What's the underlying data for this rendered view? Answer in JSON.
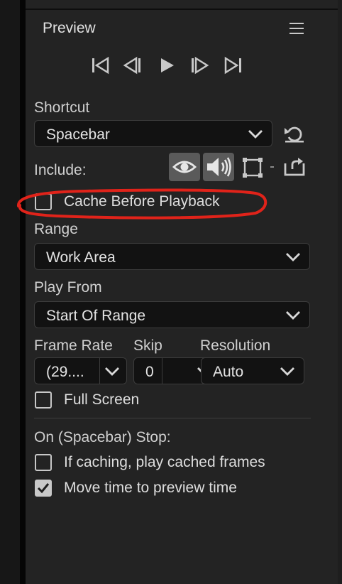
{
  "panel": {
    "title": "Preview"
  },
  "icons": {
    "menu": "hamburger-menu-icon",
    "go_to_start": "go-to-start-icon",
    "step_back": "step-back-icon",
    "play": "play-icon",
    "step_forward": "step-forward-icon",
    "go_to_end": "go-to-end-icon",
    "reset": "reset-icon",
    "eye": "eye-icon",
    "speaker": "speaker-icon",
    "frame": "frame-icon",
    "export": "export-icon"
  },
  "shortcut": {
    "label": "Shortcut",
    "value": "Spacebar"
  },
  "include": {
    "label": "Include:",
    "video_active": true,
    "audio_active": true
  },
  "cache": {
    "label": "Cache Before Playback",
    "checked": false
  },
  "range": {
    "label": "Range",
    "value": "Work Area"
  },
  "play_from": {
    "label": "Play From",
    "value": "Start Of Range"
  },
  "frame_rate": {
    "label": "Frame Rate",
    "value": "(29...."
  },
  "skip": {
    "label": "Skip",
    "value": "0"
  },
  "resolution": {
    "label": "Resolution",
    "value": "Auto"
  },
  "full_screen": {
    "label": "Full Screen",
    "checked": false
  },
  "stop": {
    "label": "On (Spacebar) Stop:",
    "options": [
      {
        "label": "If caching, play cached frames",
        "checked": false
      },
      {
        "label": "Move time to preview time",
        "checked": true
      }
    ]
  },
  "colors": {
    "annotation": "#e0231a",
    "panel_bg": "#232323",
    "field_bg": "#121212"
  }
}
